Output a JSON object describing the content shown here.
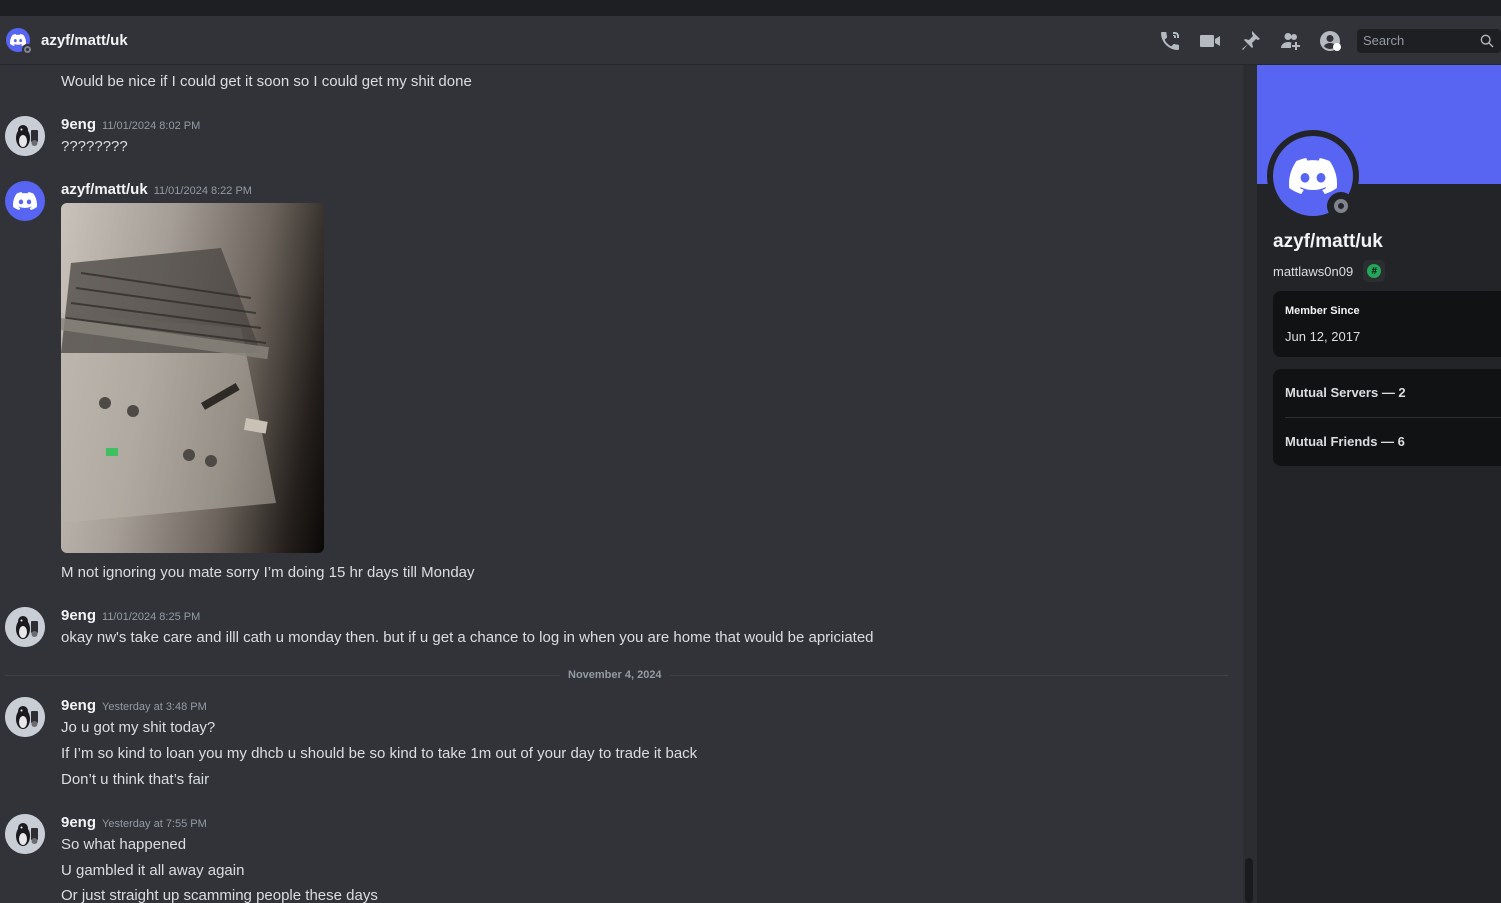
{
  "header": {
    "title": "azyf/matt/uk",
    "search_placeholder": "Search"
  },
  "messages": [
    {
      "line": "Would be nice if I could get it soon so I could get my shit done"
    },
    {
      "username": "9eng",
      "timestamp": "11/01/2024 8:02 PM",
      "lines": [
        "????????"
      ]
    },
    {
      "username": "azyf/matt/uk",
      "timestamp": "11/01/2024 8:22 PM",
      "after_image": "M not ignoring you mate sorry I’m doing 15 hr days till Monday"
    },
    {
      "username": "9eng",
      "timestamp": "11/01/2024 8:25 PM",
      "lines": [
        "okay nw's take care and illl cath u monday then. but if u get a chance to log in when you are home that would be apriciated"
      ]
    },
    {
      "username": "9eng",
      "timestamp": "Yesterday at 3:48 PM",
      "lines": [
        "Jo u got my shit today?",
        "If I’m so kind to loan you my dhcb u should be so kind to take 1m out of your day to trade it back",
        "Don’t u think that’s fair"
      ]
    },
    {
      "username": "9eng",
      "timestamp": "Yesterday at 7:55 PM",
      "lines": [
        "So what happened",
        "U gambled it all away again",
        "Or just straight up scamming people these days"
      ]
    }
  ],
  "date_divider": "November 4, 2024",
  "profile": {
    "display_name": "azyf/matt/uk",
    "username": "mattlaws0n09",
    "badge_symbol": "#",
    "member_since_label": "Member Since",
    "member_since_value": "Jun 12, 2017",
    "mutual_servers": "Mutual Servers — 2",
    "mutual_friends": "Mutual Friends — 6"
  },
  "colors": {
    "brand": "#5865f2",
    "background": "#313338",
    "sidebar": "#232428",
    "online_badge": "#23a55a"
  },
  "icons": [
    "discord-logo-icon",
    "voice-call-icon",
    "video-call-icon",
    "pin-icon",
    "add-friends-icon",
    "user-profile-icon",
    "search-icon"
  ]
}
